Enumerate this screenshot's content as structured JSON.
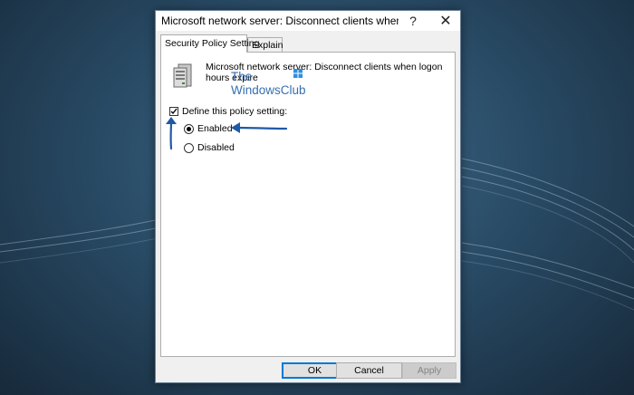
{
  "dialog": {
    "title": "Microsoft network server: Disconnect clients when logon ...",
    "help_glyph": "?",
    "close_glyph": "✕"
  },
  "tabs": [
    {
      "label": "Security Policy Setting",
      "active": true
    },
    {
      "label": "Explain",
      "active": false
    }
  ],
  "policy": {
    "name": "Microsoft network server: Disconnect clients when logon hours expire",
    "icon": "server-icon"
  },
  "watermark": {
    "line1": "The",
    "line2": "WindowsClub"
  },
  "define_setting": {
    "label": "Define this policy setting:",
    "checked": true
  },
  "options": [
    {
      "label": "Enabled",
      "selected": true
    },
    {
      "label": "Disabled",
      "selected": false
    }
  ],
  "buttons": {
    "ok": "OK",
    "cancel": "Cancel",
    "apply": "Apply"
  },
  "colors": {
    "accent": "#0078d7",
    "annotation_arrow": "#1f5aa6",
    "watermark": "#2260a8"
  }
}
